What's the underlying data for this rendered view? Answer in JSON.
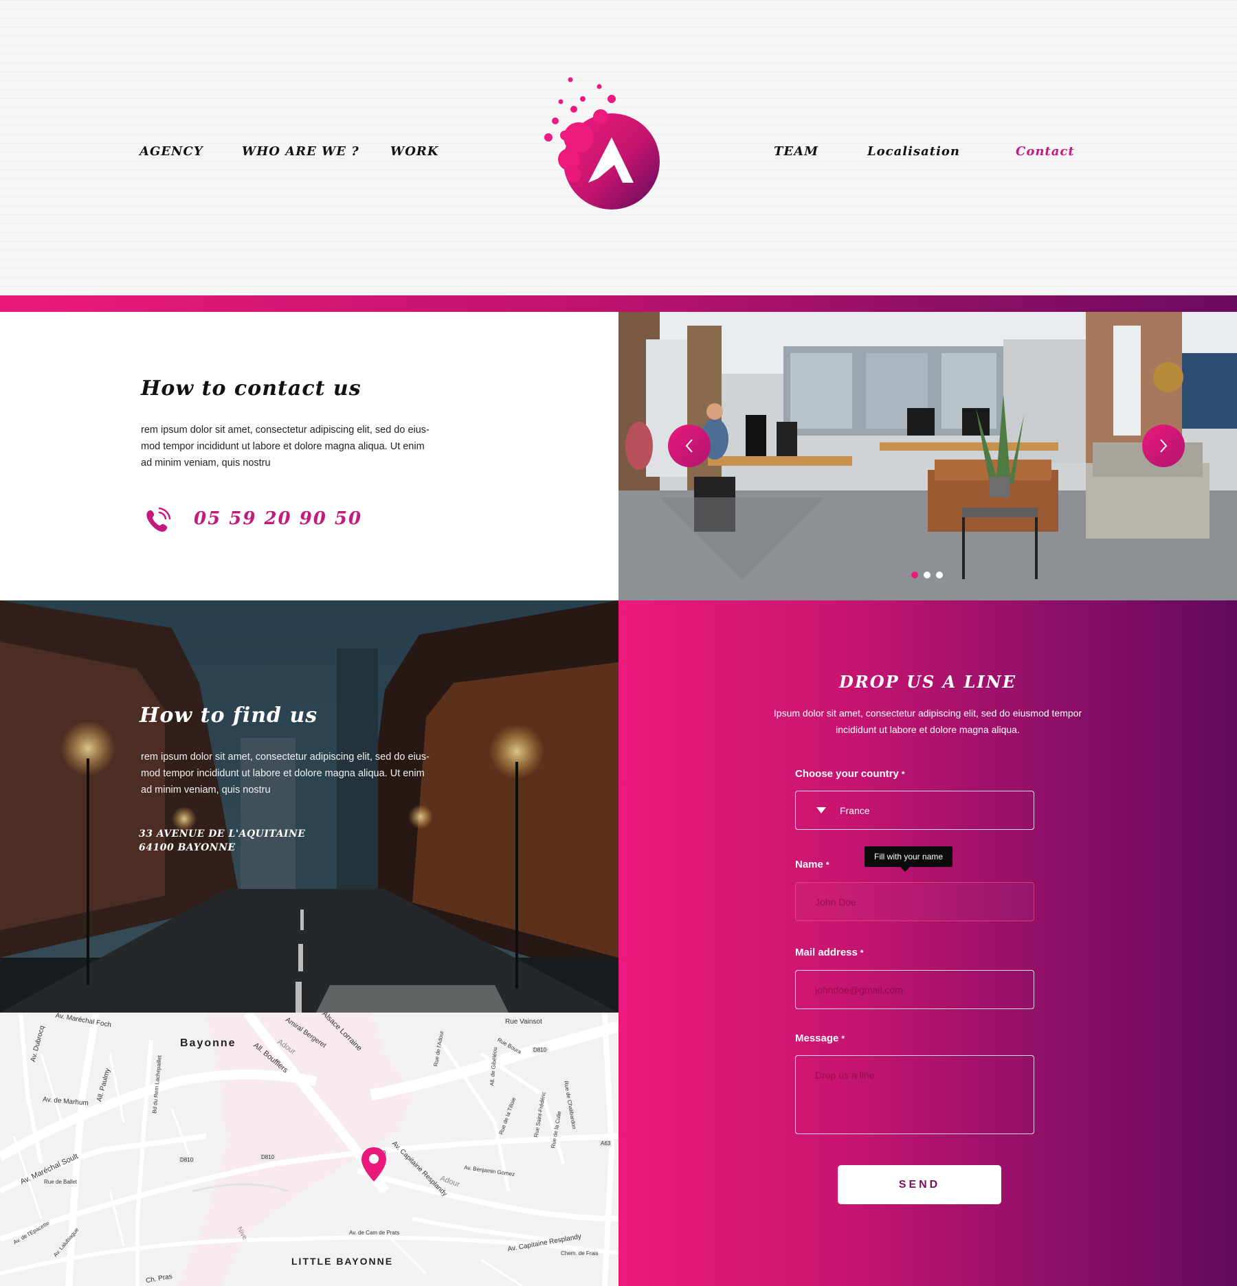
{
  "nav": {
    "left": [
      "AGENCY",
      "WHO ARE WE ?",
      "WORK"
    ],
    "right": [
      "TEAM",
      "Localisation",
      "Contact"
    ],
    "active": "Contact"
  },
  "colors": {
    "accent": "#ea1a7c",
    "accent_dark": "#62095c",
    "text": "#111111"
  },
  "contact": {
    "title": "How to contact us",
    "text": "rem ipsum dolor sit amet, consectetur adipiscing elit, sed do eius-mod tempor incididunt ut labore et dolore magna aliqua. Ut enim ad minim veniam, quis nostru",
    "phone": "05 59 20 90 50",
    "phone_icon": "phone-icon"
  },
  "slider": {
    "slides": 3,
    "active_index": 0
  },
  "find": {
    "title": "How to find us",
    "text": "rem ipsum dolor sit amet, consectetur adipiscing elit, sed do eius-mod tempor incididunt ut labore et dolore magna aliqua. Ut enim ad minim veniam, quis nostru",
    "address_line1": "33 AVENUE DE L'AQUITAINE",
    "address_line2": "64100 BAYONNE"
  },
  "map": {
    "city_main": "Bayonne",
    "city_sub": "LITTLE BAYONNE",
    "labels": {
      "dubrocq": "Av. Dubrocq",
      "marechal_foch": "Av. Maréchal Foch",
      "amiral": "Amiral Bergeret",
      "alsace": "d Alsace Lorraine",
      "adour1": "Adour",
      "boufflers": "All. Boufflers",
      "paulmy": "All. Paulmy",
      "marhum": "Av. de Marhum",
      "soult": "Av. Maréchal Soult",
      "ballet": "Rue de Ballet",
      "vainsot": "Rue Vainsot",
      "boura": "Rue Boura",
      "capitaine": "Av. Capitaine Resplandy",
      "capitaine2": "Av. Capitaine Resplandy",
      "gomez": "Av. Benjamin Gomez",
      "adour2": "Adour",
      "nive": "Nive",
      "cam": "Av. de Cam de Prats",
      "frais": "Chem. de Frais",
      "d810a": "D810",
      "d810b": "D810",
      "d810c": "D810",
      "d810d": "D810",
      "a63": "A63",
      "lachepaillet": "Bd du Rem Lachepaillet",
      "tilloie": "Rue de la Tilloie",
      "chalibardon": "Rue de Chalibardon",
      "saintfrederic": "Rue Saint-Frédéric",
      "culie": "Rue de la Culie",
      "gibeleou": "All. de Gibéléou",
      "adour_rue": "Rue de l'Adour",
      "lalubiague": "Av. Lalubiague",
      "epacette": "Av. de l'Epacette",
      "pras": "Ch. Pras"
    }
  },
  "form": {
    "title": "DROP US A LINE",
    "description": "Ipsum dolor sit amet, consectetur adipiscing elit, sed do eiusmod tempor incididunt ut labore et dolore magna aliqua.",
    "country_label": "Choose your country",
    "country_value": "France",
    "name_label": "Name",
    "name_placeholder": "John Doe",
    "name_tooltip": "Fill with your name",
    "mail_label": "Mail address",
    "mail_placeholder": "johndoe@gmail.com",
    "message_label": "Message",
    "message_placeholder": "Drop us a line",
    "required_mark": "*",
    "send_label": "SEND"
  }
}
